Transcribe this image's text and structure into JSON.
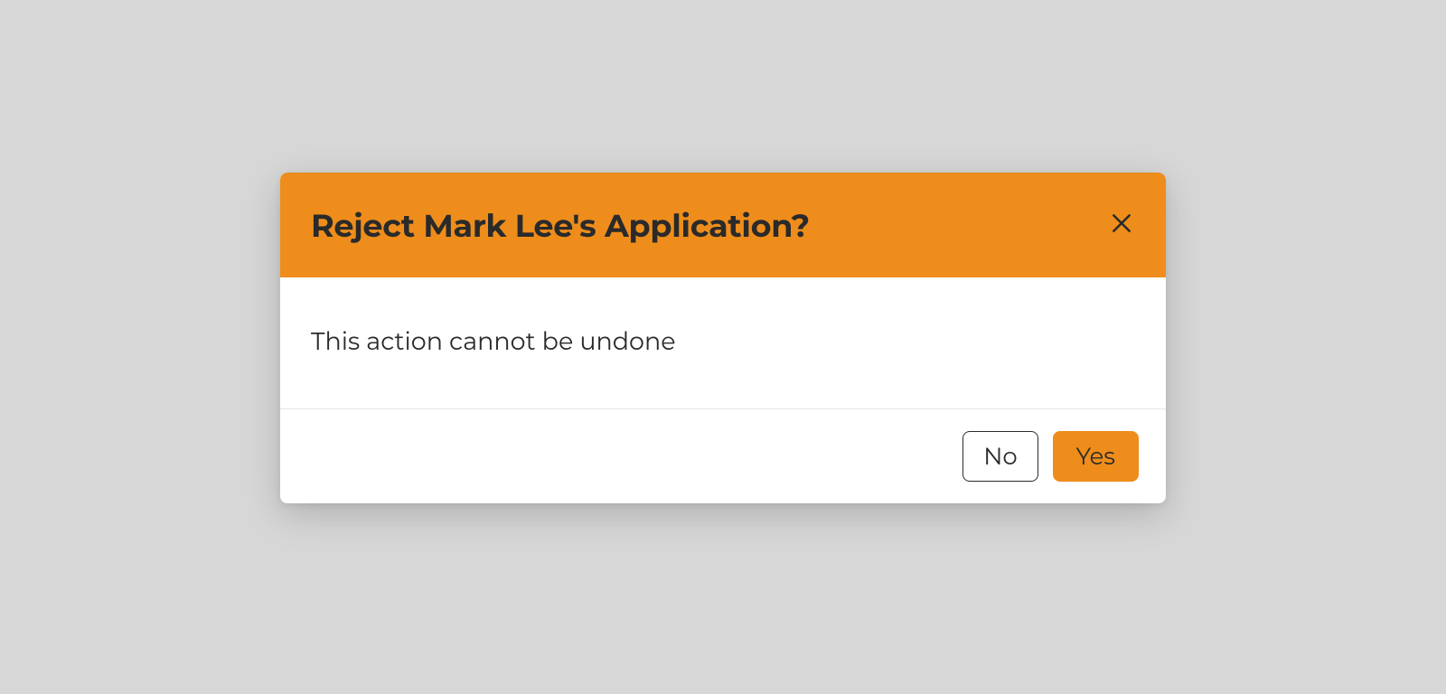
{
  "dialog": {
    "title": "Reject Mark Lee's Application?",
    "body": "This action cannot be undone",
    "buttons": {
      "no": "No",
      "yes": "Yes"
    }
  },
  "colors": {
    "accent": "#ee8d1c",
    "text": "#2a2a2a",
    "page_bg": "#d7d7d7"
  }
}
